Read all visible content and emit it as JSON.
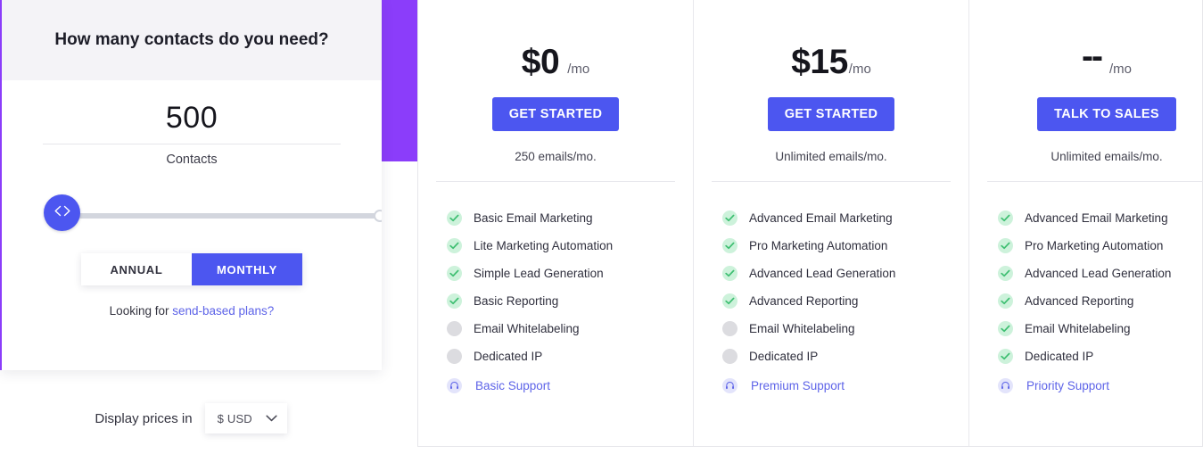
{
  "calculator": {
    "title": "How many contacts do you need?",
    "contacts_value": "500",
    "contacts_label": "Contacts",
    "slider": {
      "handle_icon": "left-right-chevrons-icon",
      "position_percent": 0
    },
    "billing_options": [
      {
        "label": "ANNUAL",
        "active": false
      },
      {
        "label": "MONTHLY",
        "active": true
      }
    ],
    "send_based": {
      "prefix": "Looking for ",
      "link_text": "send-based plans?"
    }
  },
  "currency": {
    "label": "Display prices in",
    "selected": "$ USD",
    "chevron_icon": "chevron-down-icon"
  },
  "plans": [
    {
      "price": "$0",
      "period": "/mo",
      "period_gap": true,
      "cta": "GET STARTED",
      "emails": "250 emails/mo.",
      "features": [
        {
          "label": "Basic Email Marketing",
          "state": "included"
        },
        {
          "label": "Lite Marketing Automation",
          "state": "included"
        },
        {
          "label": "Simple Lead Generation",
          "state": "included"
        },
        {
          "label": "Basic Reporting",
          "state": "included"
        },
        {
          "label": "Email Whitelabeling",
          "state": "excluded"
        },
        {
          "label": "Dedicated IP",
          "state": "excluded"
        },
        {
          "label": "Basic Support",
          "state": "support"
        }
      ]
    },
    {
      "price": "$15",
      "period": "/mo",
      "period_gap": false,
      "cta": "GET STARTED",
      "emails": "Unlimited emails/mo.",
      "features": [
        {
          "label": "Advanced Email Marketing",
          "state": "included"
        },
        {
          "label": "Pro Marketing Automation",
          "state": "included"
        },
        {
          "label": "Advanced Lead Generation",
          "state": "included"
        },
        {
          "label": "Advanced Reporting",
          "state": "included"
        },
        {
          "label": "Email Whitelabeling",
          "state": "excluded"
        },
        {
          "label": "Dedicated IP",
          "state": "excluded"
        },
        {
          "label": "Premium Support",
          "state": "support"
        }
      ]
    },
    {
      "price": "--",
      "period": "/mo",
      "period_gap": true,
      "cta": "TALK TO SALES",
      "emails": "Unlimited emails/mo.",
      "features": [
        {
          "label": "Advanced Email Marketing",
          "state": "included"
        },
        {
          "label": "Pro Marketing Automation",
          "state": "included"
        },
        {
          "label": "Advanced Lead Generation",
          "state": "included"
        },
        {
          "label": "Advanced Reporting",
          "state": "included"
        },
        {
          "label": "Email Whitelabeling",
          "state": "included"
        },
        {
          "label": "Dedicated IP",
          "state": "included"
        },
        {
          "label": "Priority Support",
          "state": "support"
        }
      ]
    }
  ],
  "colors": {
    "accent_blue": "#4c56f0",
    "accent_purple": "#8b3dfa",
    "check_green_bg": "#cdf2db",
    "check_green": "#3fbf72",
    "excluded_gray": "#dcdce0",
    "support_bg": "#e3e4fb",
    "link_blue": "#5d63e8"
  }
}
